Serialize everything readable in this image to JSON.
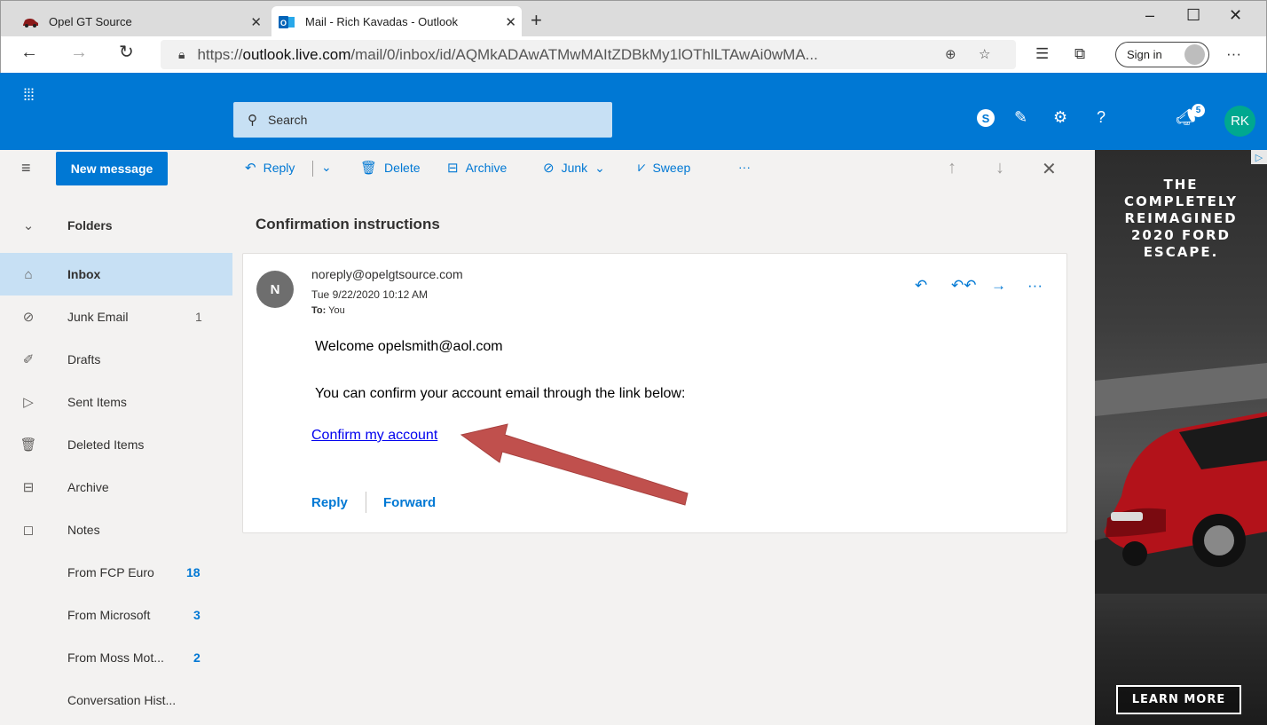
{
  "browser": {
    "tabs": [
      {
        "title": "Opel GT Source"
      },
      {
        "title": "Mail - Rich Kavadas - Outlook"
      }
    ],
    "url": {
      "scheme": "https://",
      "host": "outlook.live.com",
      "path": "/mail/0/inbox/id/AQMkADAwATMwMAItZDBkMy1lOThlLTAwAi0wMA..."
    },
    "sign_in_label": "Sign in",
    "more_label": "···"
  },
  "outlook": {
    "search_placeholder": "Search",
    "notification_count": "5",
    "user_initials": "RK",
    "help_label": "?"
  },
  "nav": {
    "new_message_label": "New message",
    "folders_header": "Folders",
    "folders": [
      {
        "label": "Inbox",
        "count": "",
        "selected": true
      },
      {
        "label": "Junk Email",
        "count": "1"
      },
      {
        "label": "Drafts",
        "count": ""
      },
      {
        "label": "Sent Items",
        "count": ""
      },
      {
        "label": "Deleted Items",
        "count": ""
      },
      {
        "label": "Archive",
        "count": ""
      },
      {
        "label": "Notes",
        "count": ""
      },
      {
        "label": "From FCP Euro",
        "count": "18"
      },
      {
        "label": "From Microsoft",
        "count": "3"
      },
      {
        "label": "From Moss Mot...",
        "count": "2"
      },
      {
        "label": "Conversation Hist...",
        "count": ""
      }
    ]
  },
  "commands": {
    "reply": "Reply",
    "delete": "Delete",
    "archive": "Archive",
    "junk": "Junk",
    "sweep": "Sweep",
    "more": "···"
  },
  "message": {
    "subject": "Confirmation instructions",
    "avatar_initial": "N",
    "sender": "noreply@opelgtsource.com",
    "date": "Tue 9/22/2020 10:12 AM",
    "to_label": "To:",
    "to_value": "You",
    "body_welcome": "Welcome opelsmith@aol.com",
    "body_instructions": "You can confirm your account email through the link below:",
    "link_text": "Confirm my account",
    "reply_label": "Reply",
    "forward_label": "Forward"
  },
  "ad": {
    "headline": [
      "THE",
      "COMPLETELY",
      "REIMAGINED",
      "2020 FORD",
      "ESCAPE."
    ],
    "cta": "LEARN MORE"
  },
  "colors": {
    "outlook_blue": "#0078d4",
    "selected_folder": "#c7e0f4",
    "annotation_arrow": "#c0504d",
    "avatar_rk": "#00a88f"
  }
}
